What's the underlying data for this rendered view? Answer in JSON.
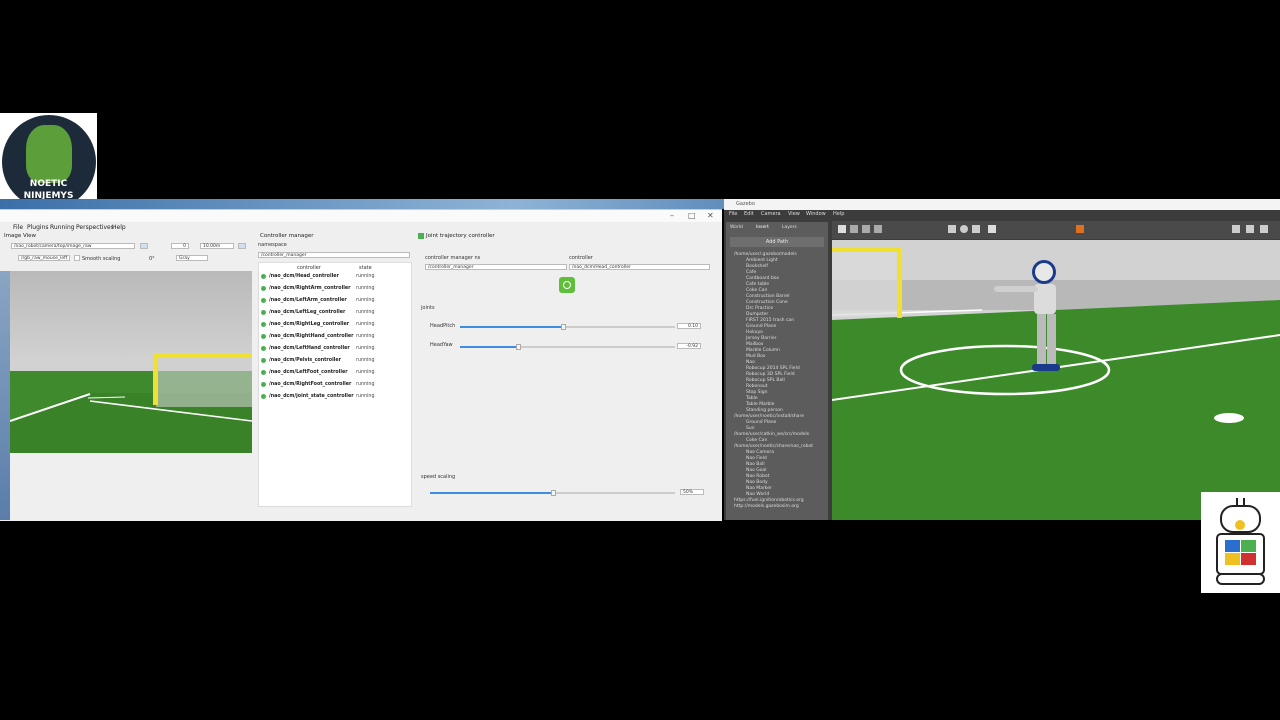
{
  "logo": {
    "line1": "NOETIC",
    "line2": "NINJEMYS"
  },
  "rqt": {
    "window_buttons": [
      "–",
      "□",
      "✕"
    ],
    "menu": [
      "File",
      "Plugins",
      "Running",
      "Perspectives",
      "Help"
    ],
    "image_view": {
      "title": "Image View",
      "topic": "/nao_robot/camera/top/image_raw",
      "val_a": "0",
      "zoom": "10.00m",
      "mouse_topic": "/rgb_raw_mouse_left",
      "smooth_label": "Smooth scaling",
      "rotation": "0°",
      "color": "Gray"
    },
    "controller_manager": {
      "title": "Controller manager",
      "namespace_label": "namespace",
      "namespace_value": "/controller_manager",
      "col_controller": "controller",
      "col_state": "state",
      "rows": [
        {
          "name": "/nao_dcm/Head_controller",
          "state": "running"
        },
        {
          "name": "/nao_dcm/RightArm_controller",
          "state": "running"
        },
        {
          "name": "/nao_dcm/LeftArm_controller",
          "state": "running"
        },
        {
          "name": "/nao_dcm/LeftLeg_controller",
          "state": "running"
        },
        {
          "name": "/nao_dcm/RightLeg_controller",
          "state": "running"
        },
        {
          "name": "/nao_dcm/RightHand_controller",
          "state": "running"
        },
        {
          "name": "/nao_dcm/LeftHand_controller",
          "state": "running"
        },
        {
          "name": "/nao_dcm/Pelvis_controller",
          "state": "running"
        },
        {
          "name": "/nao_dcm/LeftFoot_controller",
          "state": "running"
        },
        {
          "name": "/nao_dcm/RightFoot_controller",
          "state": "running"
        },
        {
          "name": "/nao_dcm/joint_state_controller",
          "state": "running"
        }
      ]
    },
    "joint_trajectory": {
      "title": "Joint trajectory controller",
      "cm_ns_label": "controller manager ns",
      "cm_ns_value": "/controller_manager",
      "controller_label": "controller",
      "controller_value": "/nao_dcm/Head_controller",
      "joints_label": "joints",
      "joints": [
        {
          "name": "HeadPitch",
          "value": "0.10",
          "fraction": 0.48
        },
        {
          "name": "HeadYaw",
          "value": "-0.92",
          "fraction": 0.27
        }
      ],
      "speed_label": "speed scaling",
      "speed_value": "50%",
      "speed_fraction": 0.5
    }
  },
  "gazebo": {
    "title": "Gazebo",
    "menu": [
      "File",
      "Edit",
      "Camera",
      "View",
      "Window",
      "Help"
    ],
    "tabs": [
      "World",
      "Insert",
      "Layers"
    ],
    "add_path": "Add Path",
    "tree": [
      "/home/user/.gazebo/models",
      "Ambient Light",
      "Bookshelf",
      "Cafe",
      "Cardboard box",
      "Cafe table",
      "Coke Can",
      "Construction Barrel",
      "Construction Cone",
      "Drc Practice",
      "Dumpster",
      "FIRST 2015 trash can",
      "Ground Plane",
      "Hokuyo",
      "Jersey Barrier",
      "Mailbox",
      "Marble Column",
      "Mud Box",
      "Nao",
      "Robocup 2014 SPL Field",
      "Robocup 3D SPL Field",
      "Robocup SPL Ball",
      "Robonaut",
      "Stop Sign",
      "Table",
      "Table Marble",
      "Standing person",
      "/home/user/noetic/install/share",
      "Ground Plane",
      "Sun",
      "/home/user/catkin_ws/src/models",
      "Coke Can",
      "/home/user/noetic/share/nao_robot",
      "Nao Camera",
      "Nao Field",
      "Nao Ball",
      "Nao Goal",
      "Nao Robot",
      "Nao Body",
      "Nao Marker",
      "Nao World",
      "https://fuel.ignitionrobotics.org",
      "http://models.gazebosim.org"
    ]
  },
  "colors": {
    "accent": "#3d8ee0",
    "running": "#4caf50",
    "gazebo_bg": "#3c3c3c",
    "field_green": "#3c8a2a",
    "goal_yellow": "#f0e030"
  }
}
